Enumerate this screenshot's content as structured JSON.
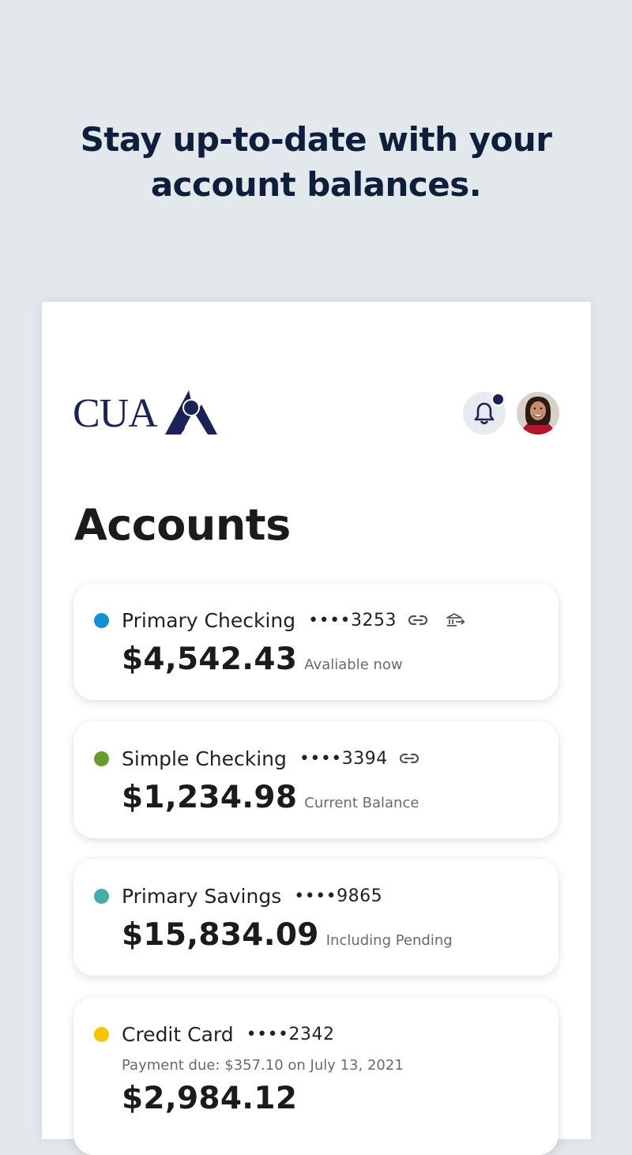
{
  "headline": {
    "line1": "Stay up-to-date with your",
    "line2": "account balances."
  },
  "header": {
    "logo_text": "CUA",
    "notification_icon": "bell-icon",
    "has_unread_notifications": true
  },
  "page_title": "Accounts",
  "accounts": [
    {
      "name": "Primary Checking",
      "number": "••••3253",
      "amount": "$4,542.43",
      "label": "Avaliable now",
      "dot_color": "#1192d6",
      "icons": [
        "link-icon",
        "bank-transfer-icon"
      ]
    },
    {
      "name": "Simple Checking",
      "number": "••••3394",
      "amount": "$1,234.98",
      "label": "Current Balance",
      "dot_color": "#6a9b2e",
      "icons": [
        "link-icon"
      ]
    },
    {
      "name": "Primary Savings",
      "number": "••••9865",
      "amount": "$15,834.09",
      "label": "Including Pending",
      "dot_color": "#46aea6",
      "icons": []
    },
    {
      "name": "Credit Card",
      "number": "••••2342",
      "payment_due": "Payment due: $357.10 on July 13, 2021",
      "amount": "$2,984.12",
      "dot_color": "#f7c400",
      "icons": []
    }
  ],
  "colors": {
    "background": "#e3e8ec",
    "headline": "#0d1f3a",
    "brand_navy": "#1a2257"
  }
}
